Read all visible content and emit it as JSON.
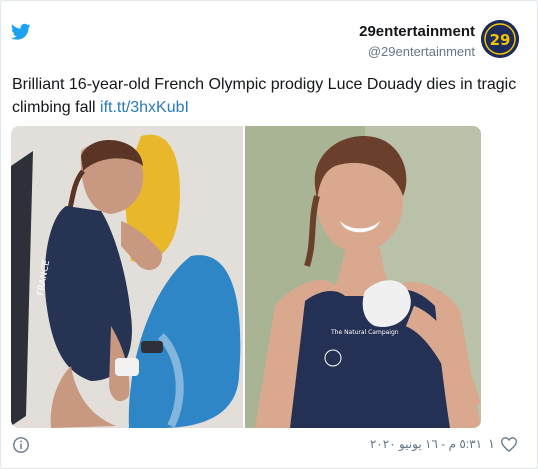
{
  "tweet": {
    "author_name": "29entertainment",
    "author_handle": "@29entertainment",
    "avatar_text": "29",
    "text": "Brilliant 16-year-old French Olympic prodigy Luce Douady dies in tragic climbing fall ",
    "link": "ift.tt/3hxKubI",
    "timestamp": "٥:٣١ م - ١٦ يونيو ٢٠٢٠",
    "like_count": "١"
  },
  "photos": {
    "left": {
      "jersey_text": "FRANCE"
    },
    "right": {
      "jersey_text": "The Natural Campaign"
    }
  },
  "icons": {
    "brand": "twitter-bird-icon",
    "info": "info-icon",
    "like": "heart-icon"
  },
  "colors": {
    "twitter_blue": "#1da1f2",
    "link_blue": "#2b7bb9",
    "muted": "#657786",
    "text": "#14171a",
    "avatar_bg": "#1c2a5c",
    "avatar_yellow": "#f5c400"
  }
}
